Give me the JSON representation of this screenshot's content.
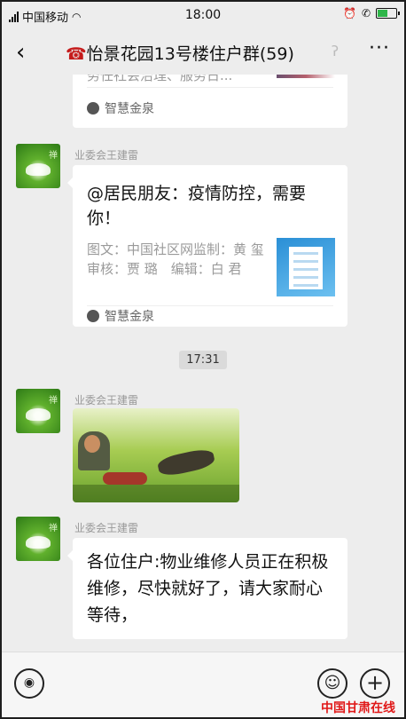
{
  "status_bar": {
    "carrier": "中国移动",
    "time": "18:00",
    "battery_level": 0.55,
    "icons": [
      "signal-icon",
      "wifi-icon",
      "alarm-icon",
      "hd-call-icon",
      "battery-icon"
    ]
  },
  "nav": {
    "back": "‹",
    "phone_glyph": "☎",
    "title": "怡景花园13号楼住户群(59)",
    "more": "···"
  },
  "messages": [
    {
      "type": "article_partial",
      "preview_text": "务任社会治理、服务日...",
      "source": "智慧金泉"
    },
    {
      "type": "article",
      "sender": "业委会王建雷",
      "title": "@居民朋友：疫情防控，需要你！",
      "desc": "图文：中国社区网监制：黄 玺　审核：贾 璐　编辑：白 君",
      "source": "智慧金泉"
    },
    {
      "type": "timestamp",
      "text": "17:31"
    },
    {
      "type": "image",
      "sender": "业委会王建雷"
    },
    {
      "type": "text",
      "sender": "业委会王建雷",
      "text": "各位住户:物业维修人员正在积极维修，尽快就好了，请大家耐心等待，"
    }
  ],
  "input_bar": {
    "voice_icon": "◉",
    "emoji_icon": "☺",
    "plus_icon": "+"
  },
  "watermark": "中国甘肃在线"
}
